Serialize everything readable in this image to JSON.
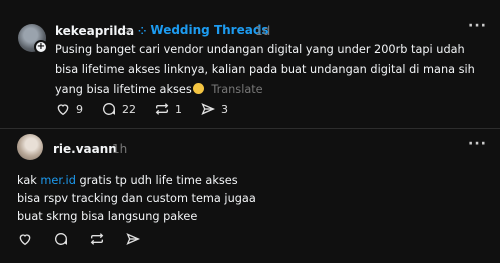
{
  "post1": {
    "username": "kekeaprilda",
    "chevron": ">",
    "community": "Wedding Threads",
    "community_dots": "⁘",
    "time": "1d",
    "text": "Pusing banget cari vendor undangan digital yang under 200rb tapi udah bisa lifetime akses linknya, kalian pada buat undangan digital di mana sih yang bisa lifetime akses",
    "translate": "Translate",
    "actions": {
      "likes": "9",
      "replies": "22",
      "reposts": "1",
      "shares": "3"
    },
    "more": "···"
  },
  "post2": {
    "username": "rie.vaann",
    "time": "1h",
    "text_prefix": "kak ",
    "link": "mer.id",
    "text_line1_rest": " gratis tp udh life time akses",
    "text_line2": "bisa rspv tracking dan custom tema jugaa",
    "text_line3": "buat skrng bisa langsung pakee",
    "more": "···"
  },
  "colors": {
    "background": "#101010",
    "text": "#f3f5f7",
    "muted": "#777777",
    "accent": "#1d9bf0"
  }
}
